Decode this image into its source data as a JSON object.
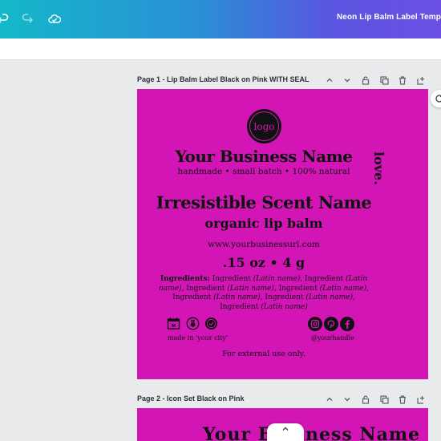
{
  "topbar": {
    "doc_title": "Neon Lip Balm Label Temp",
    "icons": [
      "undo-icon",
      "redo-icon",
      "cloud-sync-icon"
    ]
  },
  "pages": [
    {
      "title": "Page 1 - Lip Balm Label Black on Pink WITH SEAL",
      "controls": [
        "chevron-up-icon",
        "chevron-down-icon",
        "lock-icon",
        "duplicate-icon",
        "trash-icon",
        "add-page-icon"
      ]
    },
    {
      "title": "Page 2 - Icon Set Black on Pink",
      "controls": [
        "chevron-up-icon",
        "chevron-down-icon",
        "lock-icon",
        "duplicate-icon",
        "trash-icon",
        "add-page-icon"
      ]
    }
  ],
  "label": {
    "background": "#d315b6",
    "logo_text": "logo",
    "business_name": "Your Business Name",
    "tagline": "handmade • small batch • 100% natural",
    "side_text": "love.",
    "scent_name": "Irresistible Scent Name",
    "product_type": "organic lip balm",
    "url": "www.yourbusinessurl.com",
    "weight": ".15 oz • 4 g",
    "ingredients_label": "Ingredients:",
    "ingredient_word": "Ingredient",
    "latin_name": "(Latin name)",
    "made_in": "made in 'your city'",
    "handle": "@yourhandle",
    "external": "For external use only.",
    "badge_icons": [
      "calendar-icon",
      "cruelty-free-icon",
      "seal-icon"
    ],
    "social_icons": [
      "instagram-icon",
      "pinterest-icon",
      "facebook-icon"
    ]
  },
  "page2_peek": "Your Business Name"
}
